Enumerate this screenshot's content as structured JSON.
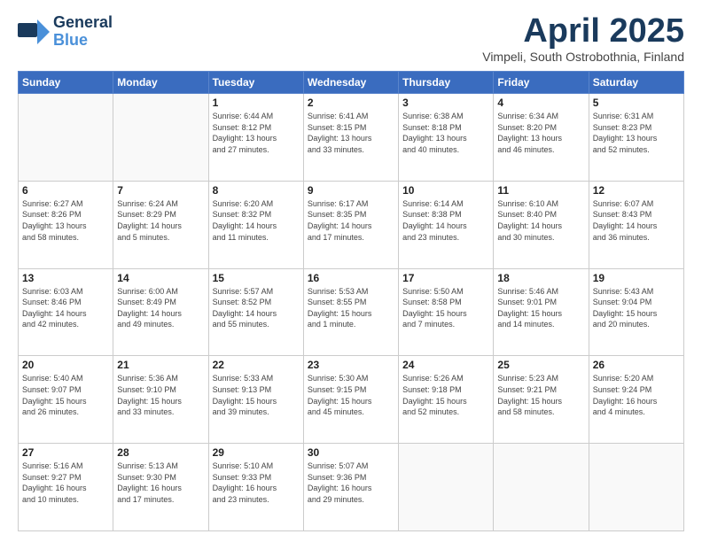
{
  "logo": {
    "general": "General",
    "blue": "Blue"
  },
  "header": {
    "title": "April 2025",
    "location": "Vimpeli, South Ostrobothnia, Finland"
  },
  "weekdays": [
    "Sunday",
    "Monday",
    "Tuesday",
    "Wednesday",
    "Thursday",
    "Friday",
    "Saturday"
  ],
  "weeks": [
    [
      {
        "day": "",
        "info": ""
      },
      {
        "day": "",
        "info": ""
      },
      {
        "day": "1",
        "info": "Sunrise: 6:44 AM\nSunset: 8:12 PM\nDaylight: 13 hours\nand 27 minutes."
      },
      {
        "day": "2",
        "info": "Sunrise: 6:41 AM\nSunset: 8:15 PM\nDaylight: 13 hours\nand 33 minutes."
      },
      {
        "day": "3",
        "info": "Sunrise: 6:38 AM\nSunset: 8:18 PM\nDaylight: 13 hours\nand 40 minutes."
      },
      {
        "day": "4",
        "info": "Sunrise: 6:34 AM\nSunset: 8:20 PM\nDaylight: 13 hours\nand 46 minutes."
      },
      {
        "day": "5",
        "info": "Sunrise: 6:31 AM\nSunset: 8:23 PM\nDaylight: 13 hours\nand 52 minutes."
      }
    ],
    [
      {
        "day": "6",
        "info": "Sunrise: 6:27 AM\nSunset: 8:26 PM\nDaylight: 13 hours\nand 58 minutes."
      },
      {
        "day": "7",
        "info": "Sunrise: 6:24 AM\nSunset: 8:29 PM\nDaylight: 14 hours\nand 5 minutes."
      },
      {
        "day": "8",
        "info": "Sunrise: 6:20 AM\nSunset: 8:32 PM\nDaylight: 14 hours\nand 11 minutes."
      },
      {
        "day": "9",
        "info": "Sunrise: 6:17 AM\nSunset: 8:35 PM\nDaylight: 14 hours\nand 17 minutes."
      },
      {
        "day": "10",
        "info": "Sunrise: 6:14 AM\nSunset: 8:38 PM\nDaylight: 14 hours\nand 23 minutes."
      },
      {
        "day": "11",
        "info": "Sunrise: 6:10 AM\nSunset: 8:40 PM\nDaylight: 14 hours\nand 30 minutes."
      },
      {
        "day": "12",
        "info": "Sunrise: 6:07 AM\nSunset: 8:43 PM\nDaylight: 14 hours\nand 36 minutes."
      }
    ],
    [
      {
        "day": "13",
        "info": "Sunrise: 6:03 AM\nSunset: 8:46 PM\nDaylight: 14 hours\nand 42 minutes."
      },
      {
        "day": "14",
        "info": "Sunrise: 6:00 AM\nSunset: 8:49 PM\nDaylight: 14 hours\nand 49 minutes."
      },
      {
        "day": "15",
        "info": "Sunrise: 5:57 AM\nSunset: 8:52 PM\nDaylight: 14 hours\nand 55 minutes."
      },
      {
        "day": "16",
        "info": "Sunrise: 5:53 AM\nSunset: 8:55 PM\nDaylight: 15 hours\nand 1 minute."
      },
      {
        "day": "17",
        "info": "Sunrise: 5:50 AM\nSunset: 8:58 PM\nDaylight: 15 hours\nand 7 minutes."
      },
      {
        "day": "18",
        "info": "Sunrise: 5:46 AM\nSunset: 9:01 PM\nDaylight: 15 hours\nand 14 minutes."
      },
      {
        "day": "19",
        "info": "Sunrise: 5:43 AM\nSunset: 9:04 PM\nDaylight: 15 hours\nand 20 minutes."
      }
    ],
    [
      {
        "day": "20",
        "info": "Sunrise: 5:40 AM\nSunset: 9:07 PM\nDaylight: 15 hours\nand 26 minutes."
      },
      {
        "day": "21",
        "info": "Sunrise: 5:36 AM\nSunset: 9:10 PM\nDaylight: 15 hours\nand 33 minutes."
      },
      {
        "day": "22",
        "info": "Sunrise: 5:33 AM\nSunset: 9:13 PM\nDaylight: 15 hours\nand 39 minutes."
      },
      {
        "day": "23",
        "info": "Sunrise: 5:30 AM\nSunset: 9:15 PM\nDaylight: 15 hours\nand 45 minutes."
      },
      {
        "day": "24",
        "info": "Sunrise: 5:26 AM\nSunset: 9:18 PM\nDaylight: 15 hours\nand 52 minutes."
      },
      {
        "day": "25",
        "info": "Sunrise: 5:23 AM\nSunset: 9:21 PM\nDaylight: 15 hours\nand 58 minutes."
      },
      {
        "day": "26",
        "info": "Sunrise: 5:20 AM\nSunset: 9:24 PM\nDaylight: 16 hours\nand 4 minutes."
      }
    ],
    [
      {
        "day": "27",
        "info": "Sunrise: 5:16 AM\nSunset: 9:27 PM\nDaylight: 16 hours\nand 10 minutes."
      },
      {
        "day": "28",
        "info": "Sunrise: 5:13 AM\nSunset: 9:30 PM\nDaylight: 16 hours\nand 17 minutes."
      },
      {
        "day": "29",
        "info": "Sunrise: 5:10 AM\nSunset: 9:33 PM\nDaylight: 16 hours\nand 23 minutes."
      },
      {
        "day": "30",
        "info": "Sunrise: 5:07 AM\nSunset: 9:36 PM\nDaylight: 16 hours\nand 29 minutes."
      },
      {
        "day": "",
        "info": ""
      },
      {
        "day": "",
        "info": ""
      },
      {
        "day": "",
        "info": ""
      }
    ]
  ]
}
